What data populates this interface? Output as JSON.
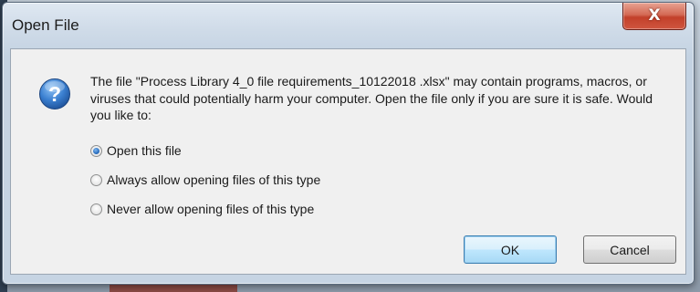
{
  "dialog": {
    "title": "Open File",
    "close_glyph": "X",
    "icon": "question-icon",
    "message": "The file \"Process Library 4_0 file requirements_10122018 .xlsx\" may contain programs, macros, or viruses that could potentially harm your computer. Open the file only if you are sure it is safe. Would you like to:",
    "options": [
      {
        "label": "Open this file",
        "selected": true
      },
      {
        "label": "Always allow opening files of this type",
        "selected": false
      },
      {
        "label": "Never allow opening files of this type",
        "selected": false
      }
    ],
    "buttons": {
      "ok": "OK",
      "cancel": "Cancel"
    }
  },
  "colors": {
    "close_button": "#c7412b",
    "default_button_border": "#3c7fb1",
    "icon_blue": "#2f6fbf"
  }
}
